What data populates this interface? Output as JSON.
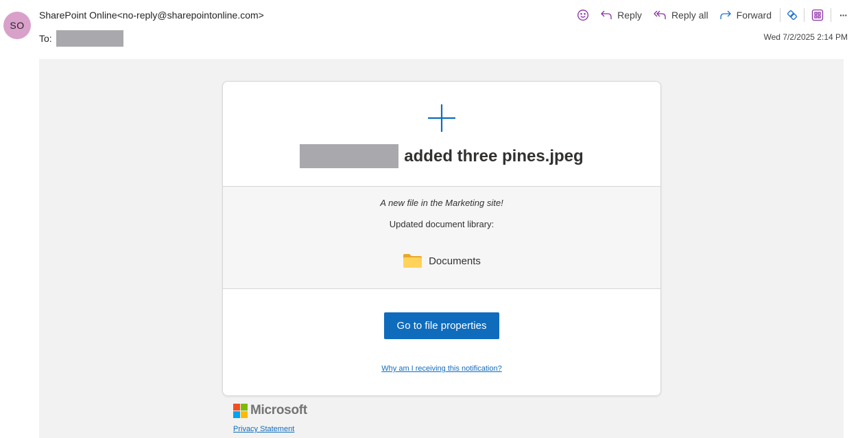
{
  "header": {
    "avatar_initials": "SO",
    "sender": "SharePoint Online<no-reply@sharepointonline.com>",
    "to_label": "To:",
    "date": "Wed 7/2/2025 2:14 PM"
  },
  "actions": {
    "reply": "Reply",
    "reply_all": "Reply all",
    "forward": "Forward",
    "more": "···"
  },
  "card": {
    "headline_suffix": "added three pines.jpeg",
    "tagline": "A new file in the Marketing site!",
    "updated_label": "Updated document library:",
    "library_name": "Documents",
    "cta_label": "Go to file properties",
    "why_link": "Why am I receiving this notification?"
  },
  "footer": {
    "logo_text": "Microsoft",
    "privacy_link": "Privacy Statement"
  },
  "colors": {
    "accent": "#0f6cbd",
    "avatar_bg": "#d9a0c9",
    "apps_icon": "#8a2da5"
  },
  "icons": [
    "emoji-icon",
    "reply-icon",
    "reply-all-icon",
    "forward-icon",
    "loop-icon",
    "apps-icon",
    "more-icon",
    "plus-icon",
    "folder-icon",
    "microsoft-logo-icon"
  ]
}
